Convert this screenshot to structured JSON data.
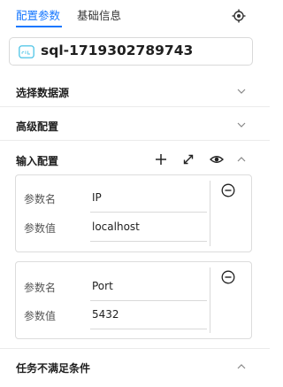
{
  "tabs": [
    {
      "label": "配置参数",
      "active": true
    },
    {
      "label": "基础信息",
      "active": false
    }
  ],
  "node": {
    "name": "sql-1719302789743",
    "type_icon": "sql-file-icon"
  },
  "sections": {
    "datasource": {
      "title": "选择数据源",
      "expanded": false
    },
    "advanced": {
      "title": "高级配置",
      "expanded": false
    },
    "input": {
      "title": "输入配置",
      "expanded": true,
      "tools": [
        "plus-icon",
        "expand-icon",
        "eye-icon"
      ]
    },
    "condition": {
      "title": "任务不满足条件",
      "expanded": true
    }
  },
  "params": [
    {
      "name_label": "参数名",
      "name": "IP",
      "value_label": "参数值",
      "value": "localhost"
    },
    {
      "name_label": "参数名",
      "name": "Port",
      "value_label": "参数值",
      "value": "5432"
    }
  ],
  "colors": {
    "accent": "#1677ff",
    "sql_icon": "#5ac8e8"
  }
}
